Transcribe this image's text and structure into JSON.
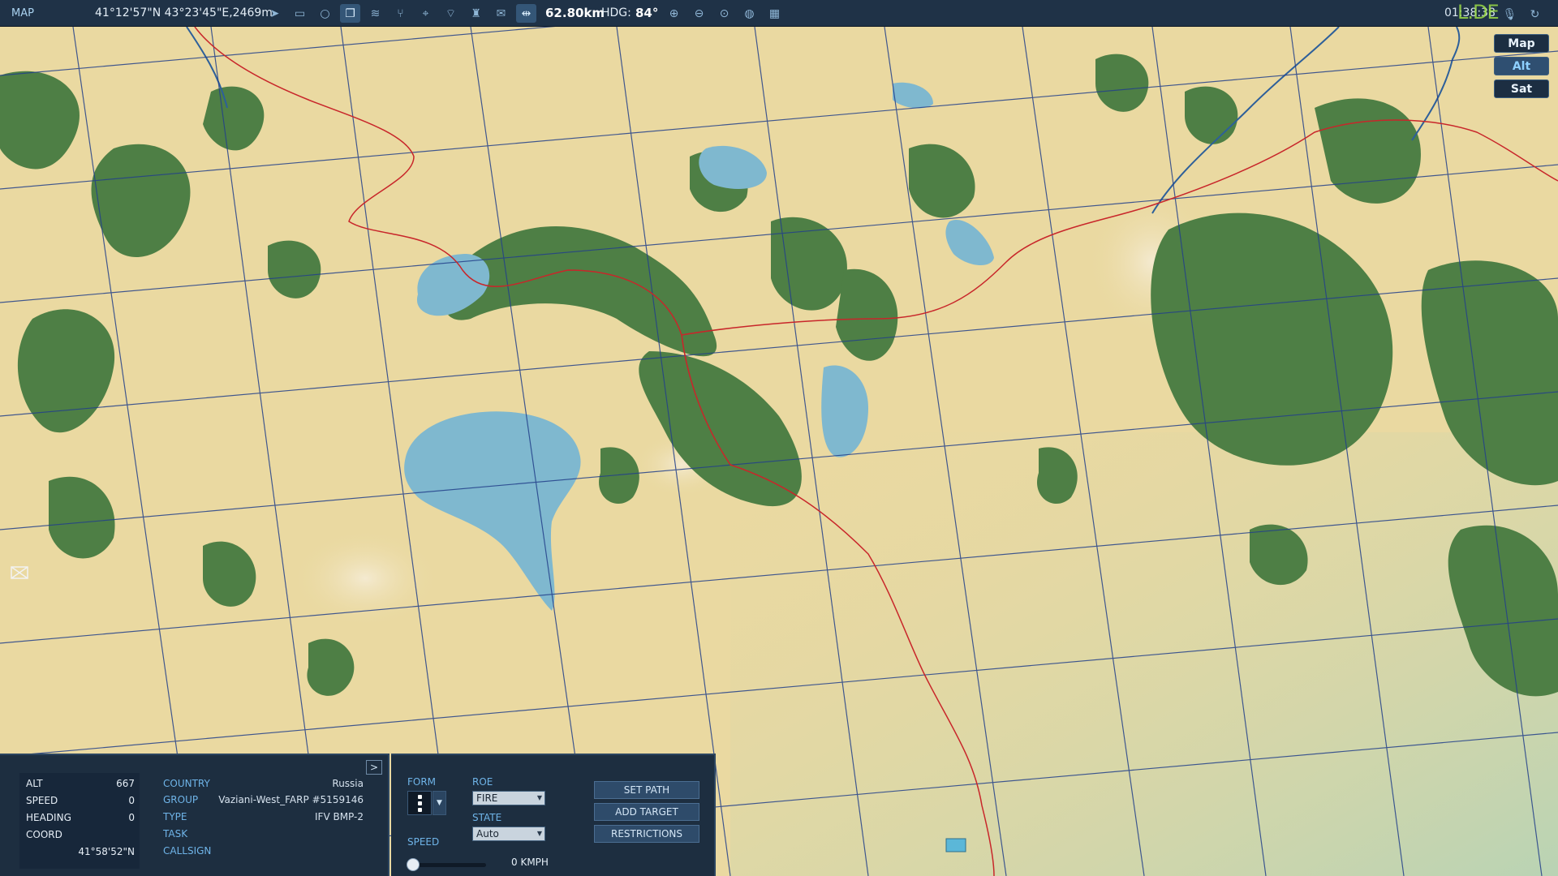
{
  "topbar": {
    "mode": "MAP",
    "coords": "41°12'57\"N 43°23'45\"E,2469m",
    "tools": [
      "cursor-icon",
      "ruler-icon",
      "circle-icon",
      "layers-icon",
      "smoke-icon",
      "route-icon",
      "crosshair-icon",
      "wifi-icon",
      "tower-icon",
      "chat-icon",
      "split-view-icon"
    ],
    "distance": "62.80km",
    "heading_label": "HDG:",
    "heading_value": "84°",
    "zoom_tools": [
      "zoom-in-icon",
      "zoom-out-icon",
      "zoom-reset-icon",
      "globe-icon",
      "grid-icon"
    ],
    "clock": "01:38:38",
    "clock_overlay": "L.DE",
    "right_icons": [
      "microphone-icon",
      "refresh-icon"
    ]
  },
  "map_types": [
    "Map",
    "Alt",
    "Sat"
  ],
  "map_type_selected": "Alt",
  "colors": {
    "terrain": "#ead9a1",
    "forest": "#4e7f45",
    "water": "#7fb8cf",
    "grid": "#23408a",
    "road": "#c8262a",
    "panel": "#1d2e40",
    "label": "#6fb4e8"
  },
  "unit_panel": {
    "toggle": ">",
    "stats": [
      {
        "label": "ALT",
        "value": "667"
      },
      {
        "label": "SPEED",
        "value": "0"
      },
      {
        "label": "HEADING",
        "value": "0"
      },
      {
        "label": "COORD",
        "value": "41°58'52\"N"
      }
    ],
    "fields": [
      {
        "label": "COUNTRY",
        "value": "Russia"
      },
      {
        "label": "GROUP",
        "value": "Vaziani-West_FARP #5159146"
      },
      {
        "label": "TYPE",
        "value": "IFV BMP-2"
      },
      {
        "label": "TASK",
        "value": ""
      },
      {
        "label": "CALLSIGN",
        "value": ""
      }
    ]
  },
  "command_panel": {
    "form_label": "FORM",
    "roe_label": "ROE",
    "roe_value": "FIRE",
    "state_label": "STATE",
    "state_value": "Auto",
    "speed_label": "SPEED",
    "speed_value": "0 KMPH",
    "speed_level": 0,
    "buttons": [
      "SET PATH",
      "ADD TARGET",
      "RESTRICTIONS"
    ]
  }
}
